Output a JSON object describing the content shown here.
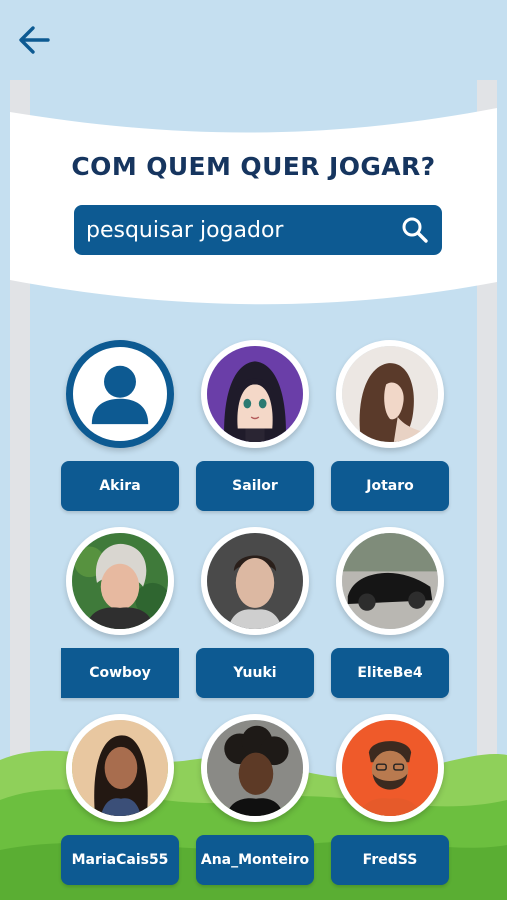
{
  "header": {
    "back_icon": "arrow-left-icon",
    "title": "COM QUEM QUER JOGAR?"
  },
  "search": {
    "placeholder": "pesquisar jogador",
    "icon": "search-icon"
  },
  "colors": {
    "background": "#c5dff0",
    "primary": "#0d5a92",
    "title": "#16355f",
    "banner": "#ffffff",
    "ground": "#6cbf3f"
  },
  "players": [
    {
      "name": "Akira",
      "avatar": "default-user-icon"
    },
    {
      "name": "Sailor",
      "avatar": "anime-girl-avatar"
    },
    {
      "name": "Jotaro",
      "avatar": "woman-photo-avatar"
    },
    {
      "name": "Cowboy",
      "avatar": "elderly-woman-photo-avatar"
    },
    {
      "name": "Yuuki",
      "avatar": "young-man-photo-avatar"
    },
    {
      "name": "EliteBe4",
      "avatar": "black-car-photo-avatar"
    },
    {
      "name": "MariaCais55",
      "avatar": "smiling-woman-photo-avatar"
    },
    {
      "name": "Ana_Monteiro",
      "avatar": "curly-hair-woman-photo-avatar"
    },
    {
      "name": "FredSS",
      "avatar": "cartoon-bearded-man-avatar"
    }
  ]
}
